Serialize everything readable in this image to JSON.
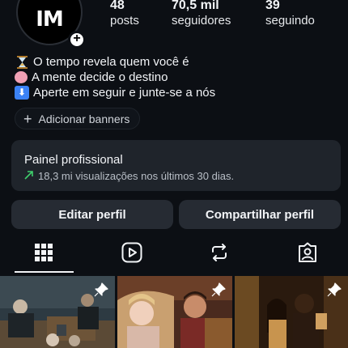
{
  "profile": {
    "avatar_text": "IM",
    "stats": [
      {
        "value": "48",
        "label": "posts"
      },
      {
        "value": "70,5 mil",
        "label": "seguidores"
      },
      {
        "value": "39",
        "label": "seguindo"
      }
    ],
    "bio": [
      {
        "icon": "hourglass-icon",
        "text": "O tempo revela quem você é"
      },
      {
        "icon": "brain-icon",
        "text": "A mente decide o destino"
      },
      {
        "icon": "down-arrow-icon",
        "text": "Aperte em seguir e junte-se a nós"
      }
    ],
    "banner_button": "Adicionar banners"
  },
  "dashboard": {
    "title": "Painel profissional",
    "subtitle": "18,3 mi visualizações nos últimos 30 dias."
  },
  "actions": {
    "edit_label": "Editar perfil",
    "share_label": "Compartilhar perfil"
  },
  "tabs": [
    {
      "icon": "grid-icon",
      "active": true
    },
    {
      "icon": "reels-icon",
      "active": false
    },
    {
      "icon": "reposts-icon",
      "active": false
    },
    {
      "icon": "tagged-icon",
      "active": false
    }
  ],
  "colors": {
    "background": "#0c0f14",
    "card": "#1f242b",
    "button": "#262b33",
    "trend_green": "#3fcf6c"
  }
}
